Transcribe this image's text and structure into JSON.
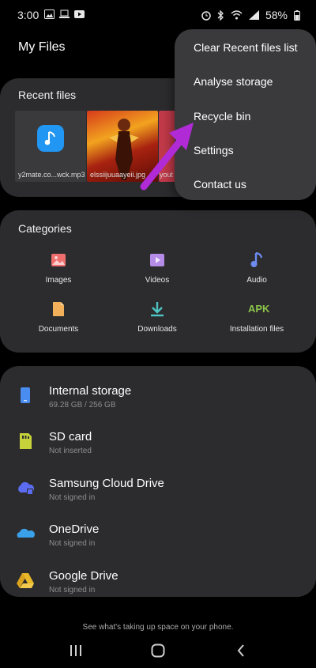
{
  "status_bar": {
    "time": "3:00",
    "battery": "58%"
  },
  "header": {
    "title": "My Files"
  },
  "recent": {
    "title": "Recent files",
    "files": [
      {
        "name": "y2mate.co...wck.mp3",
        "icon": "music-note-icon"
      },
      {
        "name": "elssiijuuaayeii.jpg",
        "icon": "image"
      },
      {
        "name": "yout",
        "icon": "image"
      }
    ]
  },
  "categories": {
    "title": "Categories",
    "items": [
      {
        "label": "Images",
        "icon": "image-icon",
        "color": "#ee6e6e"
      },
      {
        "label": "Videos",
        "icon": "video-icon",
        "color": "#b58be8"
      },
      {
        "label": "Audio",
        "icon": "audio-icon",
        "color": "#6e8cf0"
      },
      {
        "label": "Documents",
        "icon": "document-icon",
        "color": "#f3b05a"
      },
      {
        "label": "Downloads",
        "icon": "download-icon",
        "color": "#4fc6c4"
      },
      {
        "label": "Installation files",
        "icon": "apk-icon",
        "icon_text": "APK",
        "color": "#8bc34a"
      }
    ]
  },
  "storage": {
    "items": [
      {
        "name": "Internal storage",
        "sub": "69.28 GB / 256 GB",
        "icon": "phone-icon",
        "color": "#4a8df0"
      },
      {
        "name": "SD card",
        "sub": "Not inserted",
        "icon": "sd-card-icon",
        "color": "#c7d33b"
      },
      {
        "name": "Samsung Cloud Drive",
        "sub": "Not signed in",
        "icon": "cloud-icon",
        "color": "#5b6cf0"
      },
      {
        "name": "OneDrive",
        "sub": "Not signed in",
        "icon": "onedrive-icon",
        "color": "#3aa0e8"
      },
      {
        "name": "Google Drive",
        "sub": "Not signed in",
        "icon": "google-drive-icon",
        "color": "#e8b82a"
      }
    ]
  },
  "footer": {
    "hint": "See what's taking up space on your phone."
  },
  "menu": {
    "items": [
      {
        "label": "Clear Recent files list"
      },
      {
        "label": "Analyse storage"
      },
      {
        "label": "Recycle bin"
      },
      {
        "label": "Settings"
      },
      {
        "label": "Contact us"
      }
    ]
  },
  "annotation": {
    "arrow_color": "#b02bd6"
  }
}
